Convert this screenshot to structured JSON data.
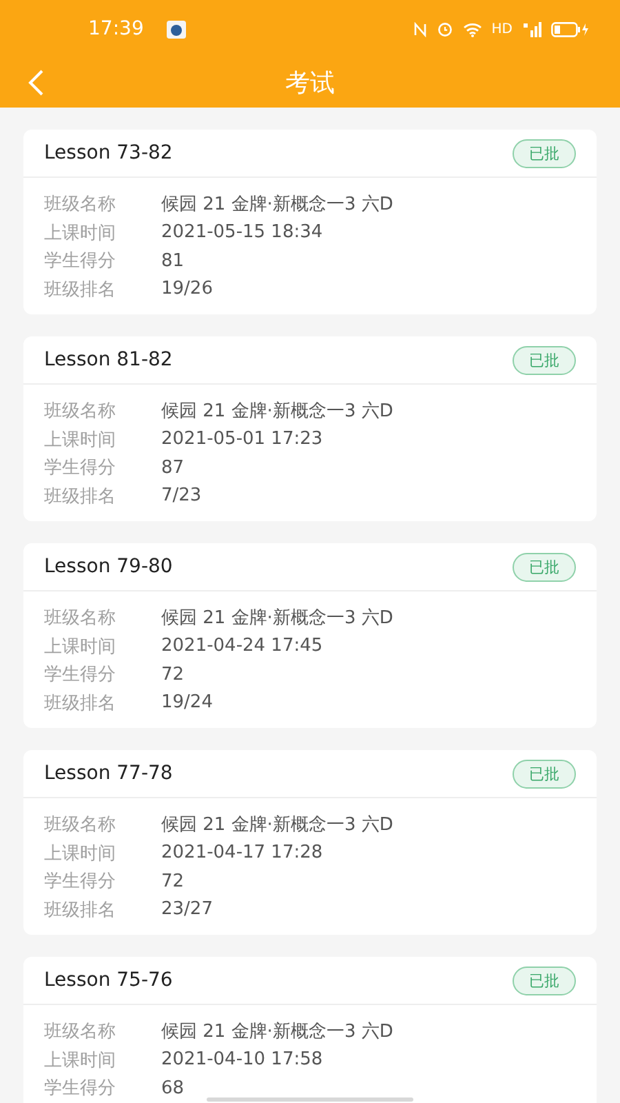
{
  "status_bar": {
    "time": "17:39",
    "network": "HD"
  },
  "header": {
    "title": "考试"
  },
  "cards": [
    {
      "title": "Lesson 73-82",
      "badge": "已批",
      "rows": [
        {
          "label": "班级名称",
          "value": "候园 21 金牌·新概念一3 六D"
        },
        {
          "label": "上课时间",
          "value": "2021-05-15 18:34"
        },
        {
          "label": "学生得分",
          "value": "81"
        },
        {
          "label": "班级排名",
          "value": "19/26"
        }
      ]
    },
    {
      "title": "Lesson 81-82",
      "badge": "已批",
      "rows": [
        {
          "label": "班级名称",
          "value": "候园 21 金牌·新概念一3 六D"
        },
        {
          "label": "上课时间",
          "value": "2021-05-01 17:23"
        },
        {
          "label": "学生得分",
          "value": "87"
        },
        {
          "label": "班级排名",
          "value": "7/23"
        }
      ]
    },
    {
      "title": "Lesson 79-80",
      "badge": "已批",
      "rows": [
        {
          "label": "班级名称",
          "value": "候园 21 金牌·新概念一3 六D"
        },
        {
          "label": "上课时间",
          "value": "2021-04-24 17:45"
        },
        {
          "label": "学生得分",
          "value": "72"
        },
        {
          "label": "班级排名",
          "value": "19/24"
        }
      ]
    },
    {
      "title": "Lesson 77-78",
      "badge": "已批",
      "rows": [
        {
          "label": "班级名称",
          "value": "候园 21 金牌·新概念一3 六D"
        },
        {
          "label": "上课时间",
          "value": "2021-04-17 17:28"
        },
        {
          "label": "学生得分",
          "value": "72"
        },
        {
          "label": "班级排名",
          "value": "23/27"
        }
      ]
    },
    {
      "title": "Lesson 75-76",
      "badge": "已批",
      "rows": [
        {
          "label": "班级名称",
          "value": "候园 21 金牌·新概念一3 六D"
        },
        {
          "label": "上课时间",
          "value": "2021-04-10 17:58"
        },
        {
          "label": "学生得分",
          "value": "68"
        }
      ]
    }
  ]
}
